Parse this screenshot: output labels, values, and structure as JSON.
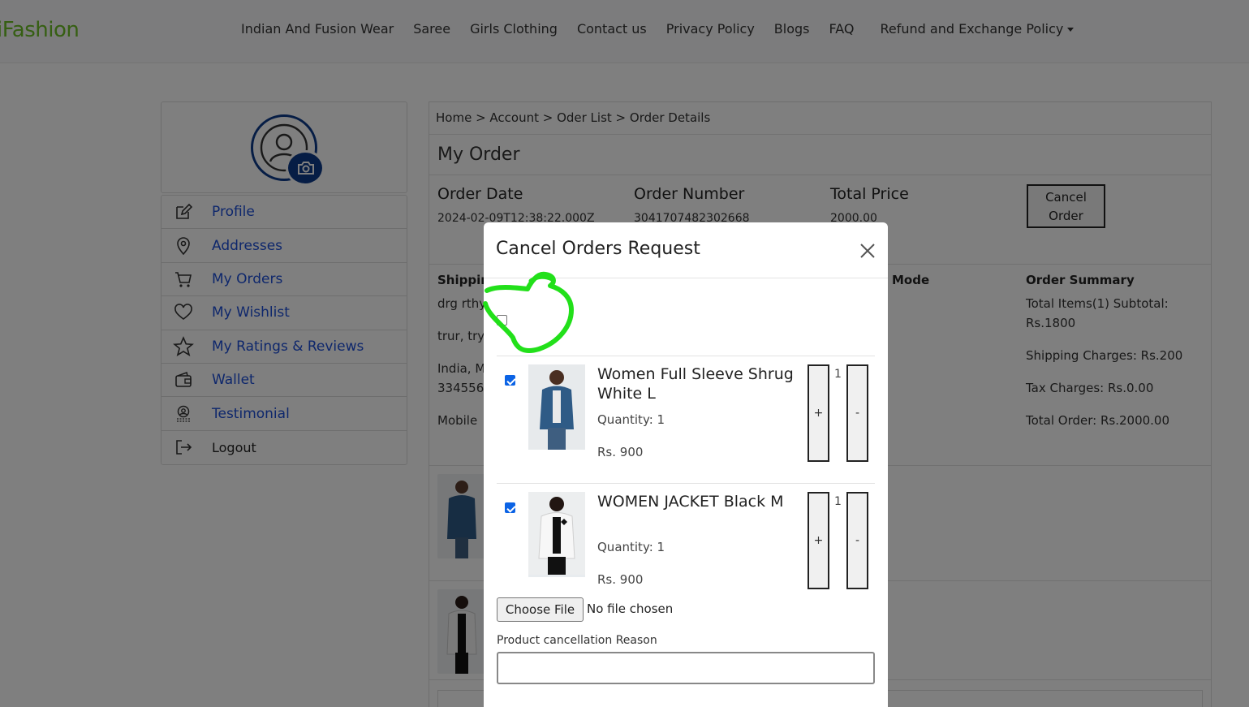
{
  "brand": "iFashion",
  "nav": {
    "links": [
      "Indian And Fusion Wear",
      "Saree",
      "Girls Clothing",
      "Contact us",
      "Privacy Policy",
      "Blogs",
      "FAQ"
    ],
    "dropdown": "Refund and Exchange Policy"
  },
  "sidebar": {
    "items": [
      {
        "label": "Profile",
        "icon": "edit-icon"
      },
      {
        "label": "Addresses",
        "icon": "location-pin-icon"
      },
      {
        "label": "My Orders",
        "icon": "cart-icon"
      },
      {
        "label": "My Wishlist",
        "icon": "heart-icon"
      },
      {
        "label": "My Ratings & Reviews",
        "icon": "star-icon"
      },
      {
        "label": "Wallet",
        "icon": "wallet-icon"
      },
      {
        "label": "Testimonial",
        "icon": "testimonial-icon"
      },
      {
        "label": "Logout",
        "icon": "logout-icon"
      }
    ]
  },
  "breadcrumb": "Home > Account > Oder List > Order Details",
  "page_title": "My Order",
  "order": {
    "date_label": "Order Date",
    "date_value": "2024-02-09T12:38:22.000Z",
    "number_label": "Order Number",
    "number_value": "3041707482302668",
    "total_label": "Total Price",
    "total_value": "2000.00",
    "cancel_label": "Cancel Order"
  },
  "shipping": {
    "heading": "Shippin",
    "line1": "drg rthy",
    "line2": "trur, tryi",
    "line3": "India, M",
    "line4": "334556",
    "mobile": "Mobile"
  },
  "payment_heading": "Mode",
  "summary": {
    "heading": "Order Summary",
    "items_line1": "Total Items(1) Subtotal:",
    "items_line2": "Rs.1800",
    "shipping": "Shipping Charges: Rs.200",
    "tax": "Tax Charges: Rs.0.00",
    "total": "Total Order: Rs.2000.00"
  },
  "modal": {
    "title": "Cancel Orders Request",
    "items": [
      {
        "name": "Women Full Sleeve Shrug White L",
        "quantity": "Quantity: 1",
        "price": "Rs. 900",
        "qty": "1",
        "plus": "+",
        "minus": "-"
      },
      {
        "name": "WOMEN JACKET Black M",
        "quantity": "Quantity: 1",
        "price": "Rs. 900",
        "qty": "1",
        "plus": "+",
        "minus": "-"
      }
    ],
    "file_button": "Choose File",
    "file_status": "No file chosen",
    "reason_label": "Product cancellation Reason",
    "reason_value": ""
  },
  "colors": {
    "brand_green": "#6cbf27",
    "link_blue": "#1d4ed8",
    "avatar_navy": "#0d3a8a",
    "checkbox_blue": "#0b63e5",
    "annotation_green": "#22e01a"
  }
}
